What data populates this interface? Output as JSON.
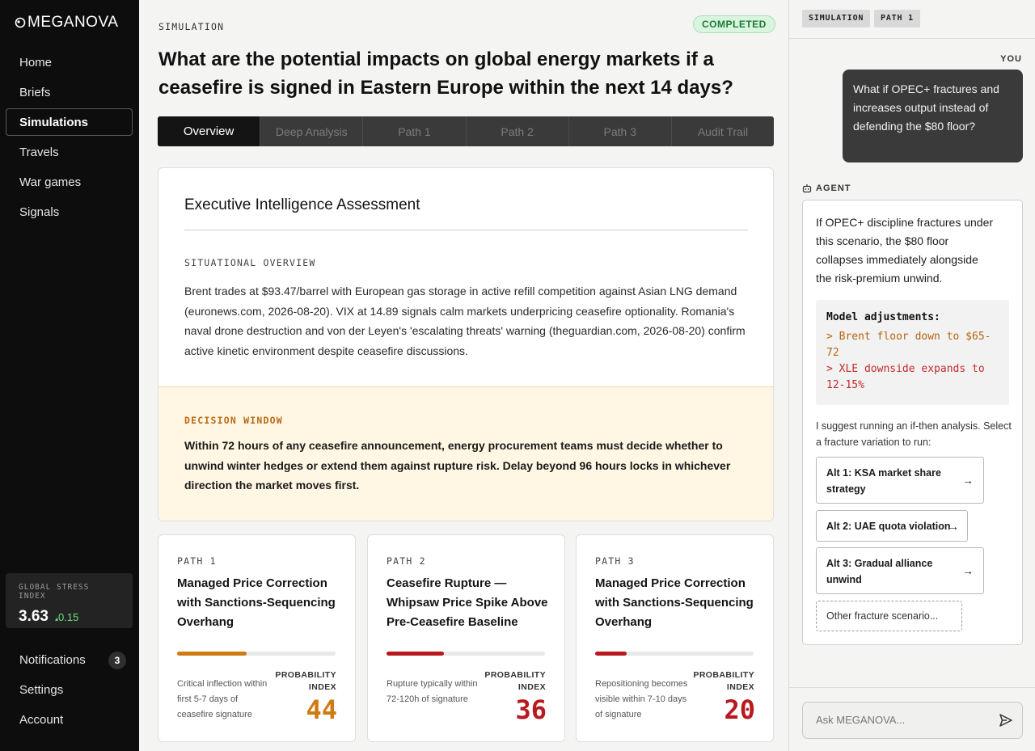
{
  "app": {
    "name": "MEGANOVA"
  },
  "sidebar": {
    "items": [
      {
        "label": "Home"
      },
      {
        "label": "Briefs"
      },
      {
        "label": "Simulations"
      },
      {
        "label": "Travels"
      },
      {
        "label": "War games"
      },
      {
        "label": "Signals"
      }
    ],
    "gsi": {
      "label": "GLOBAL STRESS INDEX",
      "value": "3.63",
      "delta": "0.15"
    },
    "bottom": [
      {
        "label": "Notifications",
        "badge": "3"
      },
      {
        "label": "Settings"
      },
      {
        "label": "Account"
      }
    ]
  },
  "main": {
    "crumb": "SIMULATION",
    "status": "COMPLETED",
    "title": "What are the potential impacts on global energy markets if a ceasefire is signed in Eastern Europe within the next 14 days?",
    "tabs": [
      {
        "label": "Overview"
      },
      {
        "label": "Deep Analysis"
      },
      {
        "label": "Path 1"
      },
      {
        "label": "Path 2"
      },
      {
        "label": "Path 3"
      },
      {
        "label": "Audit Trail"
      }
    ],
    "assessment": {
      "title": "Executive Intelligence Assessment",
      "overview_label": "SITUATIONAL OVERVIEW",
      "overview_text": "Brent trades at $93.47/barrel with European gas storage in active refill competition against Asian LNG demand (euronews.com, 2026-08-20). VIX at 14.89 signals calm markets underpricing ceasefire optionality. Romania's naval drone destruction and von der Leyen's 'escalating threats' warning (theguardian.com, 2026-08-20) confirm active kinetic environment despite ceasefire discussions.",
      "decision_label": "DECISION WINDOW",
      "decision_text": "Within 72 hours of any ceasefire announcement, energy procurement teams must decide whether to unwind winter hedges or extend them against rupture risk. Delay beyond 96 hours locks in whichever direction the market moves first."
    },
    "paths": [
      {
        "label": "PATH 1",
        "title": "Managed Price Correction with Sanctions-Sequencing Overhang",
        "note": "Critical inflection within first 5-7 days of ceasefire signature",
        "prob_label": "PROBABILITY INDEX",
        "prob": "44",
        "fill": 0.44,
        "color": "#d07a12"
      },
      {
        "label": "PATH 2",
        "title": "Ceasefire Rupture — Whipsaw Price Spike Above Pre-Ceasefire Baseline",
        "note": "Rupture typically within 72-120h of signature",
        "prob_label": "PROBABILITY INDEX",
        "prob": "36",
        "fill": 0.36,
        "color": "#b8191f"
      },
      {
        "label": "PATH 3",
        "title": "Managed Price Correction with Sanctions-Sequencing Overhang",
        "note": "Repositioning becomes visible within 7-10 days of signature",
        "prob_label": "PROBABILITY INDEX",
        "prob": "20",
        "fill": 0.2,
        "color": "#b8191f"
      }
    ]
  },
  "panel": {
    "chips": [
      "SIMULATION",
      "PATH 1"
    ],
    "you_label": "YOU",
    "you_message": "What if OPEC+ fractures and increases output instead of defending the $80 floor?",
    "agent_label": "AGENT",
    "agent_text": "If OPEC+ discipline fractures under this scenario, the $80 floor collapses immediately alongside the risk-premium unwind.",
    "code": {
      "title": "Model adjustments:",
      "line1": "> Brent floor down to $65-72",
      "line2": "> XLE downside expands to 12-15%"
    },
    "suggest": "I suggest running an if-then analysis. Select a fracture variation to run:",
    "alts": [
      {
        "label": "Alt 1: KSA market share strategy"
      },
      {
        "label": "Alt 2: UAE quota violation"
      },
      {
        "label": "Alt 3: Gradual alliance unwind"
      }
    ],
    "alt_other": "Other fracture scenario...",
    "ask_placeholder": "Ask MEGANOVA..."
  }
}
